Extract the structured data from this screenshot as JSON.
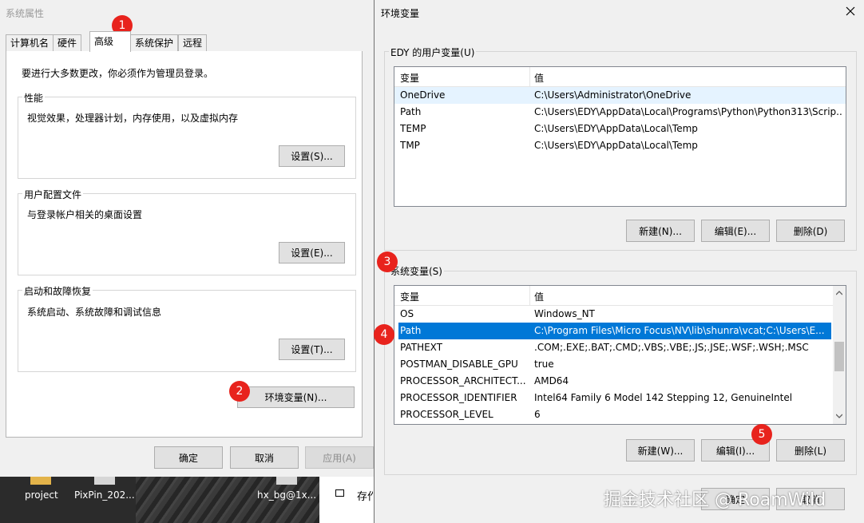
{
  "desktop": {
    "icons": [
      "project",
      "PixPin_202...",
      "hx_bg@1x..."
    ],
    "partial_item": "存作"
  },
  "system_properties": {
    "title": "系统属性",
    "tabs": [
      "计算机名",
      "硬件",
      "高级",
      "系统保护",
      "远程"
    ],
    "active_tab": "高级",
    "admin_note": "要进行大多数更改，你必须作为管理员登录。",
    "performance": {
      "title": "性能",
      "desc": "视觉效果，处理器计划，内存使用，以及虚拟内存",
      "button": "设置(S)..."
    },
    "user_profiles": {
      "title": "用户配置文件",
      "desc": "与登录帐户相关的桌面设置",
      "button": "设置(E)..."
    },
    "startup_recovery": {
      "title": "启动和故障恢复",
      "desc": "系统启动、系统故障和调试信息",
      "button": "设置(T)..."
    },
    "env_button": "环境变量(N)...",
    "ok": "确定",
    "cancel": "取消",
    "apply": "应用(A)"
  },
  "env_dialog": {
    "title": "环境变量",
    "close_icon": "close-icon",
    "user_section": {
      "title": "EDY 的用户变量(U)",
      "columns": [
        "变量",
        "值"
      ],
      "rows": [
        {
          "name": "OneDrive",
          "value": "C:\\Users\\Administrator\\OneDrive"
        },
        {
          "name": "Path",
          "value": "C:\\Users\\EDY\\AppData\\Local\\Programs\\Python\\Python313\\Scrip..."
        },
        {
          "name": "TEMP",
          "value": "C:\\Users\\EDY\\AppData\\Local\\Temp"
        },
        {
          "name": "TMP",
          "value": "C:\\Users\\EDY\\AppData\\Local\\Temp"
        }
      ],
      "buttons": {
        "new": "新建(N)...",
        "edit": "编辑(E)...",
        "delete": "删除(D)"
      }
    },
    "system_section": {
      "title": "系统变量(S)",
      "columns": [
        "变量",
        "值"
      ],
      "rows": [
        {
          "name": "OS",
          "value": "Windows_NT"
        },
        {
          "name": "Path",
          "value": "C:\\Program Files\\Micro Focus\\NV\\lib\\shunra\\vcat;C:\\Users\\E..."
        },
        {
          "name": "PATHEXT",
          "value": ".COM;.EXE;.BAT;.CMD;.VBS;.VBE;.JS;.JSE;.WSF;.WSH;.MSC"
        },
        {
          "name": "POSTMAN_DISABLE_GPU",
          "value": "true"
        },
        {
          "name": "PROCESSOR_ARCHITECT...",
          "value": "AMD64"
        },
        {
          "name": "PROCESSOR_IDENTIFIER",
          "value": "Intel64 Family 6 Model 142 Stepping 12, GenuineIntel"
        },
        {
          "name": "PROCESSOR_LEVEL",
          "value": "6"
        }
      ],
      "selected_row": "Path",
      "buttons": {
        "new": "新建(W)...",
        "edit": "编辑(I)...",
        "delete": "删除(L)"
      }
    },
    "ok": "确定",
    "cancel": "取消"
  },
  "annotations": [
    "1",
    "2",
    "3",
    "4",
    "5"
  ],
  "watermark": "掘金技术社区 @ RoamWild",
  "colors": {
    "badge": "#e8231d",
    "selection": "#0078d7",
    "hover": "#e5f3ff"
  }
}
